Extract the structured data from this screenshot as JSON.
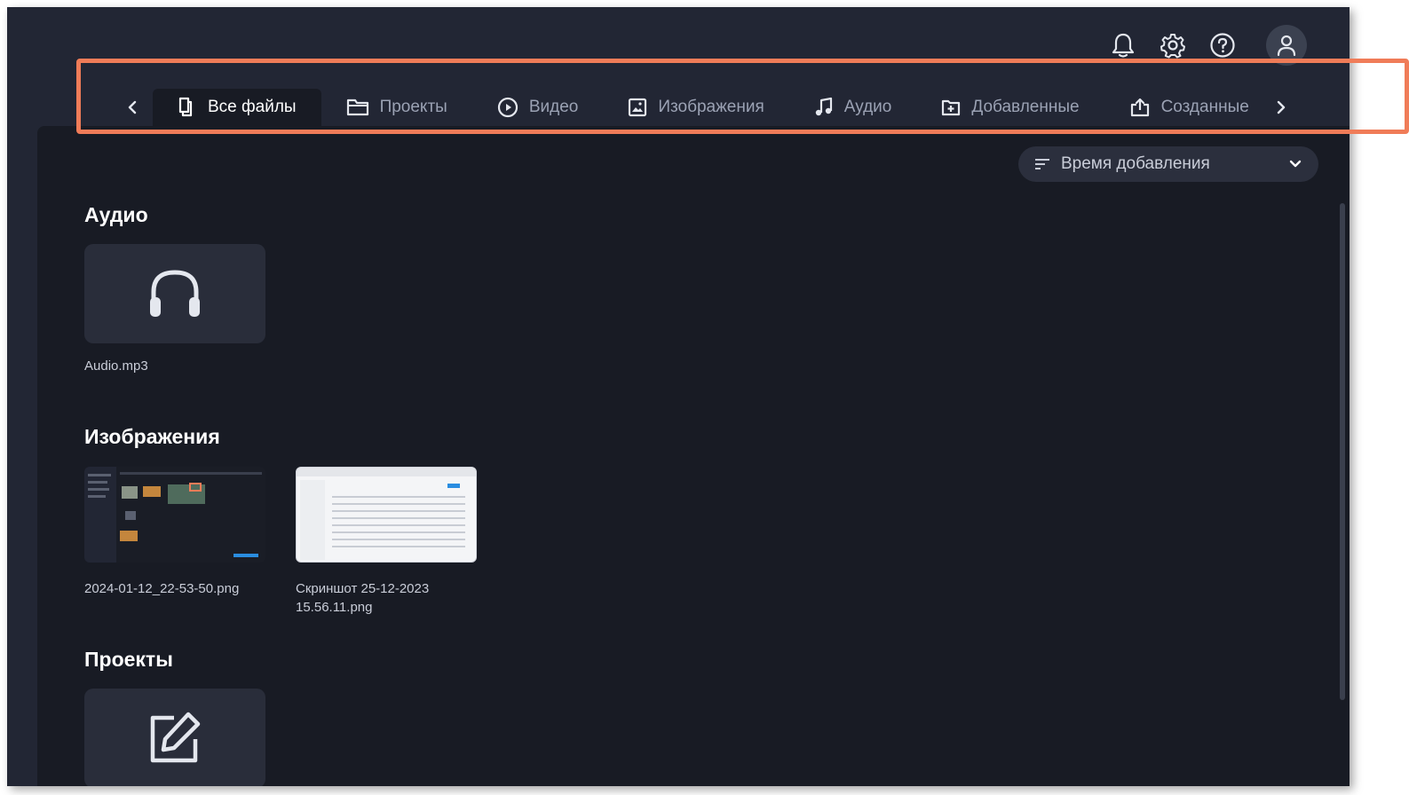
{
  "window": {
    "top_icons": [
      "bell-icon",
      "gear-icon",
      "help-icon",
      "user-icon"
    ]
  },
  "tabs": [
    {
      "label": "Все файлы",
      "icon": "files-icon",
      "active": true
    },
    {
      "label": "Проекты",
      "icon": "folder-icon",
      "active": false
    },
    {
      "label": "Видео",
      "icon": "play-circle-icon",
      "active": false
    },
    {
      "label": "Изображения",
      "icon": "image-icon",
      "active": false
    },
    {
      "label": "Аудио",
      "icon": "music-note-icon",
      "active": false
    },
    {
      "label": "Добавленные",
      "icon": "add-file-icon",
      "active": false
    },
    {
      "label": "Созданные",
      "icon": "share-icon",
      "active": false
    }
  ],
  "sort": {
    "label": "Время добавления"
  },
  "sections": {
    "audio": {
      "title": "Аудио",
      "items": [
        {
          "name": "Audio.mp3",
          "icon": "headphones-icon"
        }
      ]
    },
    "images": {
      "title": "Изображения",
      "items": [
        {
          "name": "2024-01-12_22-53-50.png"
        },
        {
          "name": "Скриншот 25-12-2023 15.56.11.png"
        }
      ]
    },
    "projects": {
      "title": "Проекты",
      "items": [
        {
          "icon": "edit-icon"
        }
      ]
    }
  },
  "colors": {
    "background": "#222634",
    "panel": "#181b24",
    "tile": "#292d3a",
    "highlight": "#f07c58"
  }
}
